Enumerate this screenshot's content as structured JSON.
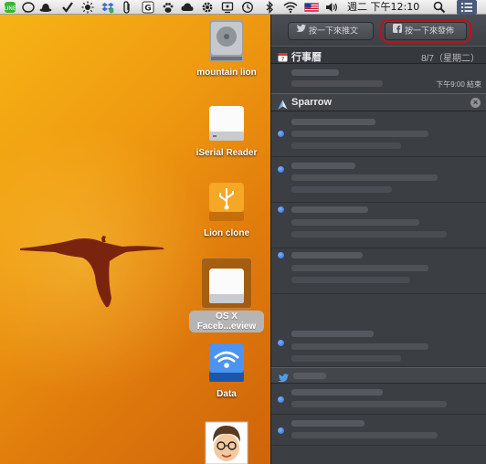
{
  "menubar": {
    "status_icons": [
      "line-icon",
      "bowler-hat-icon",
      "checkmark-icon",
      "sun-icon",
      "dropbox-icon",
      "paperclip-icon",
      "g-app-icon",
      "paw-icon",
      "cloud-icon",
      "gear-icon",
      "time-machine-icon",
      "bluetooth-icon",
      "wifi-icon",
      "flag-us-icon",
      "volume-icon"
    ],
    "clock": "週二 下午12:10",
    "search_icon": "search-icon",
    "notification_icon": "notification-list-icon"
  },
  "desktop": {
    "icons": [
      {
        "label": "mountain lion",
        "icon": "hard-drive-icon"
      },
      {
        "label": "iSerial Reader",
        "icon": "external-drive-icon"
      },
      {
        "label": "Lion clone",
        "icon": "usb-drive-icon"
      },
      {
        "label_line1": "OS X",
        "label_line2": "Faceb...eview",
        "icon": "external-drive-icon",
        "selected": true
      },
      {
        "label": "Data",
        "icon": "network-drive-icon"
      },
      {
        "label": "",
        "icon": "avatar-icon"
      }
    ]
  },
  "notification_center": {
    "tweet_button": "按一下來推文",
    "facebook_button": "按一下來發佈",
    "calendar": {
      "title": "行事曆",
      "date": "8/7（星期二）",
      "time": "下午9:00 結束"
    },
    "sparrow": {
      "title": "Sparrow",
      "unread_rows": 5
    },
    "twitter_section": {
      "icon": "twitter-bird-icon",
      "rows": 2
    }
  },
  "colors": {
    "accent_blue": "#2a66d8",
    "highlight_red": "#c0101a",
    "panel_bg": "#3b3e43",
    "desktop_orange": "#ef9a10"
  }
}
